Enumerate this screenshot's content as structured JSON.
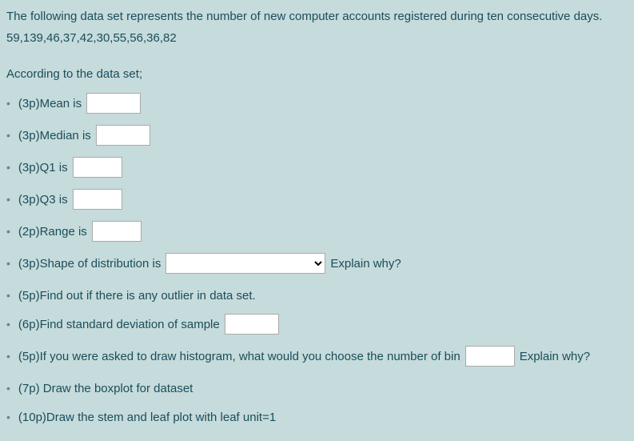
{
  "intro": "The following data set represents the number of new computer accounts registered during ten consecutive days.",
  "data_values": "59,139,46,37,42,30,55,56,36,82",
  "prompt": "According to the data set;",
  "items": {
    "mean": "(3p)Mean is",
    "median": "(3p)Median is",
    "q1": "(3p)Q1 is",
    "q3": "(3p)Q3 is",
    "range": "(2p)Range is",
    "shape": "(3p)Shape of distribution is",
    "shape_after": "Explain why?",
    "outlier": "(5p)Find out if there is any outlier in data set.",
    "stddev": "(6p)Find standard deviation of sample",
    "histogram": "(5p)If you were asked to draw histogram, what would you choose the number of bin",
    "histogram_after": "Explain why?",
    "boxplot": "(7p) Draw the boxplot for dataset",
    "stemleaf": "(10p)Draw the stem and leaf plot with leaf unit=1"
  }
}
